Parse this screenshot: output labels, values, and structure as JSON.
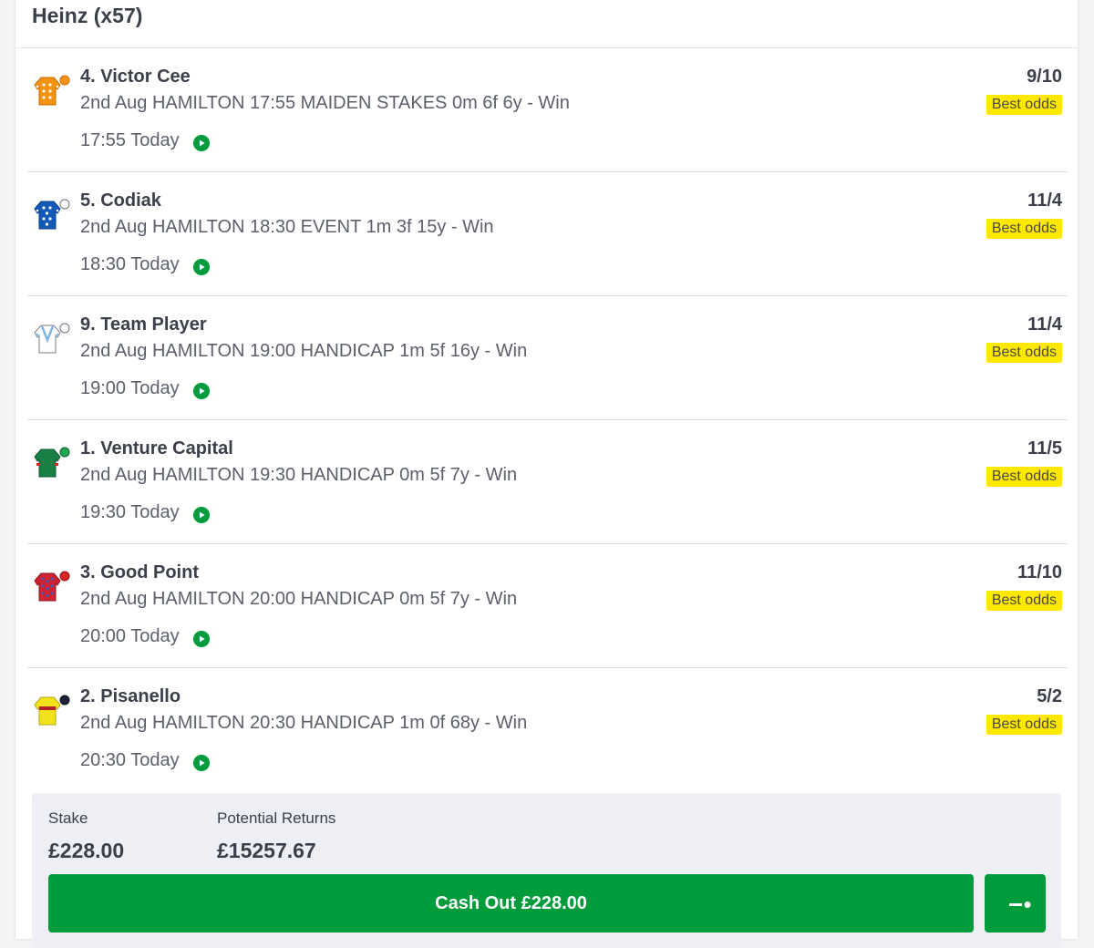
{
  "bet": {
    "title": "Heinz (x57)"
  },
  "badge_label": "Best odds",
  "colors": {
    "accent_green": "#009b3a",
    "best_odds_bg": "#ffe800"
  },
  "selections": [
    {
      "name": "4. Victor Cee",
      "race": "2nd Aug HAMILTON 17:55 MAIDEN STAKES 0m 6f 6y - Win",
      "time": "17:55 Today",
      "odds": "9/10",
      "badge": "Best odds",
      "silks_icon": "orange-silks-icon"
    },
    {
      "name": "5. Codiak",
      "race": "2nd Aug HAMILTON 18:30 EVENT 1m 3f 15y - Win",
      "time": "18:30 Today",
      "odds": "11/4",
      "badge": "Best odds",
      "silks_icon": "blue-silks-icon"
    },
    {
      "name": "9. Team Player",
      "race": "2nd Aug HAMILTON 19:00 HANDICAP 1m 5f 16y - Win",
      "time": "19:00 Today",
      "odds": "11/4",
      "badge": "Best odds",
      "silks_icon": "white-silks-icon"
    },
    {
      "name": "1. Venture Capital",
      "race": "2nd Aug HAMILTON 19:30 HANDICAP 0m 5f 7y - Win",
      "time": "19:30 Today",
      "odds": "11/5",
      "badge": "Best odds",
      "silks_icon": "green-silks-icon"
    },
    {
      "name": "3. Good Point",
      "race": "2nd Aug HAMILTON 20:00 HANDICAP 0m 5f 7y - Win",
      "time": "20:00 Today",
      "odds": "11/10",
      "badge": "Best odds",
      "silks_icon": "red-silks-icon"
    },
    {
      "name": "2. Pisanello",
      "race": "2nd Aug HAMILTON 20:30 HANDICAP 1m 0f 68y - Win",
      "time": "20:30 Today",
      "odds": "5/2",
      "badge": "Best odds",
      "silks_icon": "yellow-silks-icon"
    }
  ],
  "summary": {
    "stake_label": "Stake",
    "stake_value": "£228.00",
    "returns_label": "Potential Returns",
    "returns_value": "£15257.67",
    "cashout_label": "Cash Out £228.00",
    "partial_cashout_icon": "slider-toggle-icon"
  }
}
